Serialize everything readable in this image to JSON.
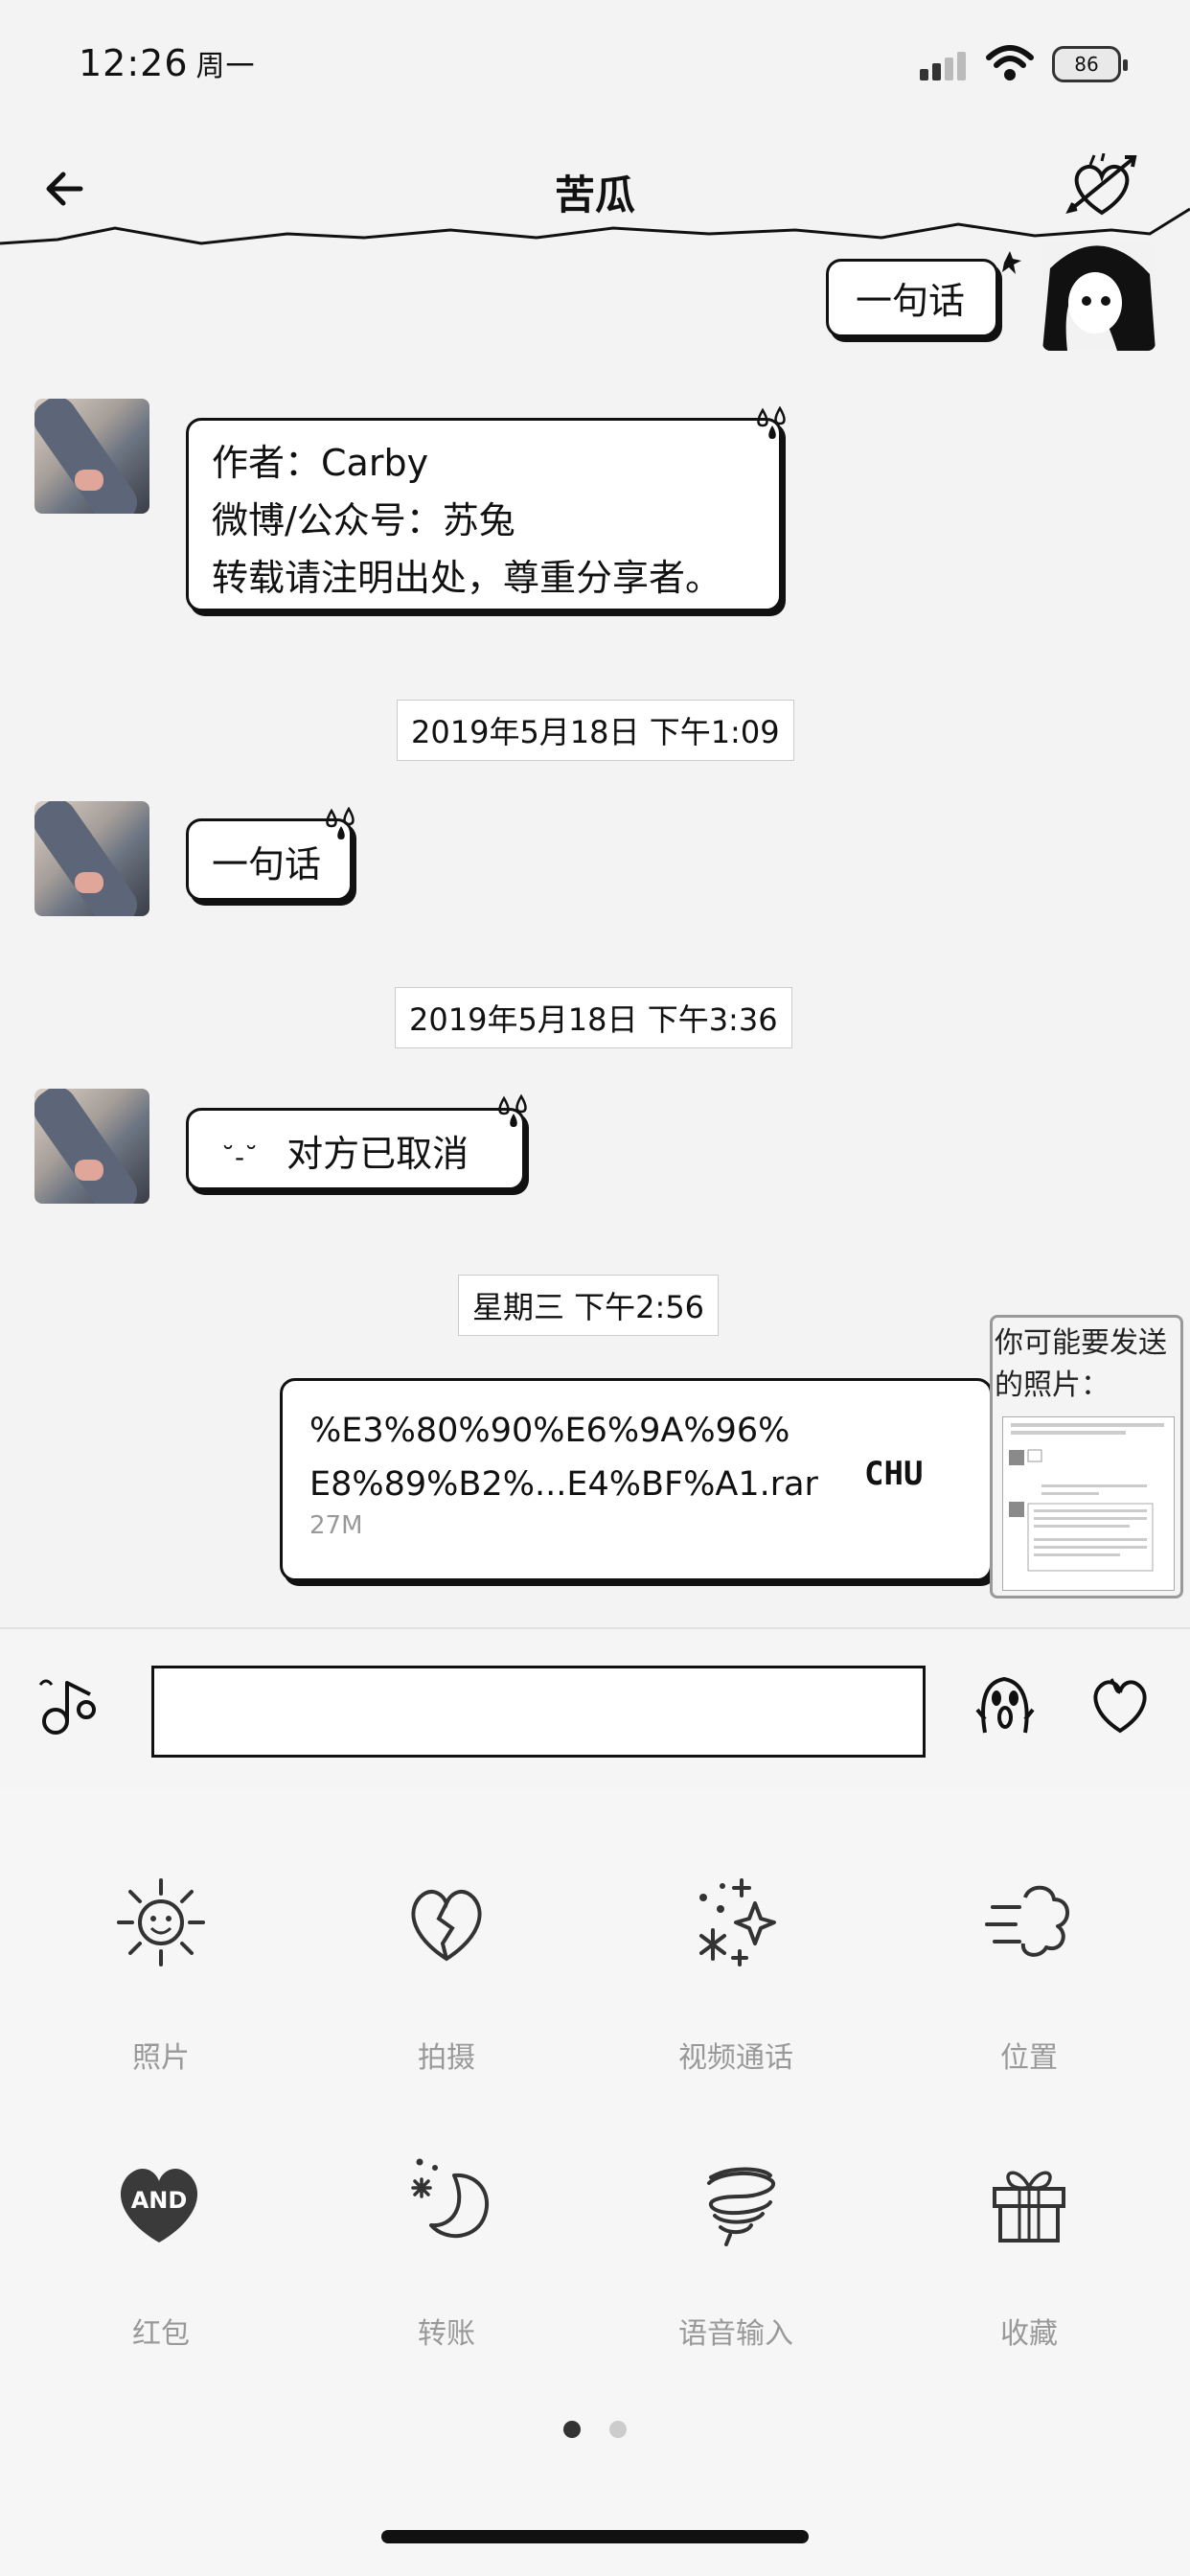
{
  "status_bar": {
    "time": "12:26",
    "day": "周一",
    "battery": "86"
  },
  "nav": {
    "title": "苦瓜"
  },
  "messages": {
    "top_sent": "一句话",
    "intro": {
      "line1": "作者：Carby",
      "line2": "微博/公众号：苏兔",
      "line3": "转载请注明出处，尊重分享者。"
    },
    "ts1": "2019年5月18日 下午1:09",
    "msg2": "一句话",
    "ts2": "2019年5月18日 下午3:36",
    "msg3_emoji": "˘-˘",
    "msg3": "对方已取消",
    "ts3": "星期三 下午2:56",
    "file": {
      "name_line1": "%E3%80%90%E6%9A%96%",
      "name_line2": "E8%89%B2%...E4%BF%A1.rar",
      "size": "27M",
      "badge": "CHU"
    }
  },
  "suggest": {
    "text": "你可能要发送的照片："
  },
  "tools": [
    {
      "label": "照片",
      "icon": "sun-icon"
    },
    {
      "label": "拍摄",
      "icon": "broken-heart-icon"
    },
    {
      "label": "视频通话",
      "icon": "sparkles-icon"
    },
    {
      "label": "位置",
      "icon": "wind-cloud-icon"
    },
    {
      "label": "红包",
      "icon": "heart-and-icon",
      "badge": "AND"
    },
    {
      "label": "转账",
      "icon": "moon-icon"
    },
    {
      "label": "语音输入",
      "icon": "spiral-icon"
    },
    {
      "label": "收藏",
      "icon": "gift-icon"
    }
  ],
  "colors": {
    "accent": "#111111",
    "background": "#f3f3f3",
    "label": "#999999"
  }
}
